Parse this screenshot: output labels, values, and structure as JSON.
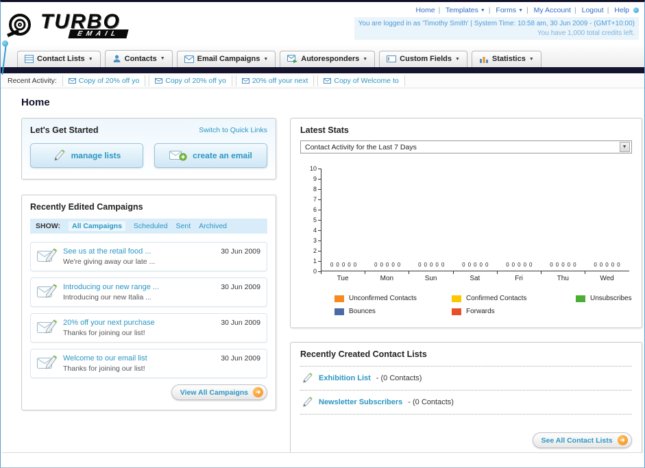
{
  "header": {
    "logo": {
      "title": "TURBO",
      "subtitle": "EMAIL"
    },
    "top_nav": [
      {
        "label": "Home",
        "has_dropdown": false
      },
      {
        "label": "Templates",
        "has_dropdown": true
      },
      {
        "label": "Forms",
        "has_dropdown": true
      },
      {
        "label": "My Account",
        "has_dropdown": false
      },
      {
        "label": "Logout",
        "has_dropdown": false
      },
      {
        "label": "Help",
        "has_dropdown": false
      }
    ],
    "session_info": "You are logged in as 'Timothy Smith' | System Time: 10:58 am, 30 Jun 2009 - (GMT+10:00)",
    "credits_info": "You have 1,000 total credits left."
  },
  "nav_tabs": [
    {
      "label": "Contact Lists"
    },
    {
      "label": "Contacts"
    },
    {
      "label": "Email Campaigns"
    },
    {
      "label": "Autoresponders"
    },
    {
      "label": "Custom Fields"
    },
    {
      "label": "Statistics"
    }
  ],
  "recent_activity": {
    "label": "Recent Activity:",
    "items": [
      {
        "text": "Copy of 20% off yo"
      },
      {
        "text": "Copy of 20% off yo"
      },
      {
        "text": "20% off your next"
      },
      {
        "text": "Copy of Welcome to"
      }
    ]
  },
  "page": {
    "title": "Home"
  },
  "get_started": {
    "title": "Let's Get Started",
    "switch_link": "Switch to Quick Links",
    "manage_lists_label": "manage lists",
    "create_email_label": "create an email"
  },
  "campaigns": {
    "title": "Recently Edited Campaigns",
    "show_label": "SHOW:",
    "filters": [
      {
        "label": "All Campaigns",
        "active": true
      },
      {
        "label": "Scheduled",
        "active": false
      },
      {
        "label": "Sent",
        "active": false
      },
      {
        "label": "Archived",
        "active": false
      }
    ],
    "items": [
      {
        "title": "See us at the retail food ...",
        "subtitle": "We're giving away our late ...",
        "date": "30 Jun 2009"
      },
      {
        "title": "Introducing our new range ...",
        "subtitle": "Introducing our new Italia ...",
        "date": "30 Jun 2009"
      },
      {
        "title": "20% off your next purchase",
        "subtitle": "Thanks for joining our list!",
        "date": "30 Jun 2009"
      },
      {
        "title": "Welcome to our email list",
        "subtitle": "Thanks for joining our list!",
        "date": "30 Jun 2009"
      }
    ],
    "view_all_label": "View All Campaigns"
  },
  "stats": {
    "title": "Latest Stats",
    "period_selector": "Contact Activity for the Last 7 Days"
  },
  "chart_data": {
    "type": "bar",
    "title": "Contact Activity for the Last 7 Days",
    "categories": [
      "Tue",
      "Mon",
      "Sun",
      "Sat",
      "Fri",
      "Thu",
      "Wed"
    ],
    "series": [
      {
        "name": "Unconfirmed Contacts",
        "color": "#f6891f",
        "values": [
          0,
          0,
          0,
          0,
          0,
          0,
          0
        ]
      },
      {
        "name": "Confirmed Contacts",
        "color": "#fdc700",
        "values": [
          0,
          0,
          0,
          0,
          0,
          0,
          0
        ]
      },
      {
        "name": "Unsubscribes",
        "color": "#4caf35",
        "values": [
          0,
          0,
          0,
          0,
          0,
          0,
          0
        ]
      },
      {
        "name": "Bounces",
        "color": "#4a69a5",
        "values": [
          0,
          0,
          0,
          0,
          0,
          0,
          0
        ]
      },
      {
        "name": "Forwards",
        "color": "#e8502a",
        "values": [
          0,
          0,
          0,
          0,
          0,
          0,
          0
        ]
      }
    ],
    "xlabel": "",
    "ylabel": "",
    "ylim": [
      0,
      10
    ],
    "yticks": [
      0,
      1,
      2,
      3,
      4,
      5,
      6,
      7,
      8,
      9,
      10
    ],
    "grid": false,
    "legend_position": "bottom"
  },
  "contact_lists": {
    "title": "Recently Created Contact Lists",
    "items": [
      {
        "name": "Exhibition List",
        "detail": "- (0 Contacts)"
      },
      {
        "name": "Newsletter Subscribers",
        "detail": "- (0 Contacts)"
      }
    ],
    "see_all_label": "See All Contact Lists"
  },
  "colors": {
    "accent_teal": "#2b96c3",
    "nav_bar_dark": "#14142e",
    "link_blue": "#2d6cc0",
    "highlight_blue": "#d9ecf9",
    "button_orange": "#f68b1f"
  }
}
